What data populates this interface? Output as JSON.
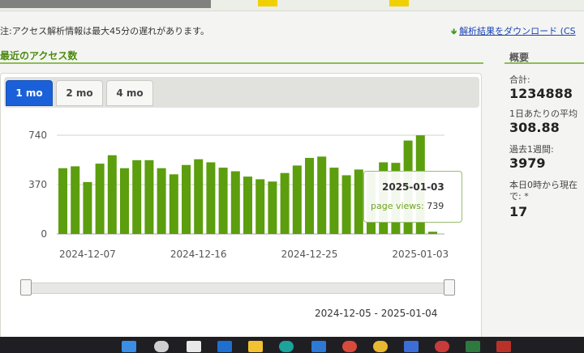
{
  "notice": "注:アクセス解析情報は最大45分の遅れがあります。",
  "download_link": "解析結果をダウンロード (CS",
  "section_title": "最近のアクセス数",
  "tabs": [
    {
      "label": "1 mo",
      "active": true
    },
    {
      "label": "2 mo",
      "active": false
    },
    {
      "label": "4 mo",
      "active": false
    }
  ],
  "chart_data": {
    "type": "bar",
    "series_name": "page views",
    "y_ticks": [
      0,
      370,
      740
    ],
    "ylim": [
      0,
      740
    ],
    "x_tick_labels": [
      "2024-12-07",
      "2024-12-16",
      "2024-12-25",
      "2025-01-03"
    ],
    "categories": [
      "2024-12-05",
      "2024-12-06",
      "2024-12-07",
      "2024-12-08",
      "2024-12-09",
      "2024-12-10",
      "2024-12-11",
      "2024-12-12",
      "2024-12-13",
      "2024-12-14",
      "2024-12-15",
      "2024-12-16",
      "2024-12-17",
      "2024-12-18",
      "2024-12-19",
      "2024-12-20",
      "2024-12-21",
      "2024-12-22",
      "2024-12-23",
      "2024-12-24",
      "2024-12-25",
      "2024-12-26",
      "2024-12-27",
      "2024-12-28",
      "2024-12-29",
      "2024-12-30",
      "2024-12-31",
      "2025-01-01",
      "2025-01-02",
      "2025-01-03",
      "2025-01-04"
    ],
    "values": [
      493,
      507,
      389,
      527,
      590,
      493,
      553,
      553,
      493,
      447,
      517,
      560,
      537,
      497,
      470,
      430,
      410,
      393,
      457,
      513,
      570,
      580,
      497,
      440,
      483,
      473,
      537,
      533,
      700,
      739,
      17
    ],
    "bar_color": "#5c9e0e",
    "tooltip": {
      "date": "2025-01-03",
      "label": "page views:",
      "value": "739"
    },
    "range_label": "2024-12-05 - 2025-01-04"
  },
  "summary": {
    "title": "概要",
    "items": [
      {
        "label": "合計:",
        "value": "1234888"
      },
      {
        "label": "1日あたりの平均",
        "value": "308.88"
      },
      {
        "label": "過去1週間:",
        "value": "3979"
      },
      {
        "label": "本日0時から現在",
        "label2": "で: *",
        "value": "17"
      }
    ]
  }
}
